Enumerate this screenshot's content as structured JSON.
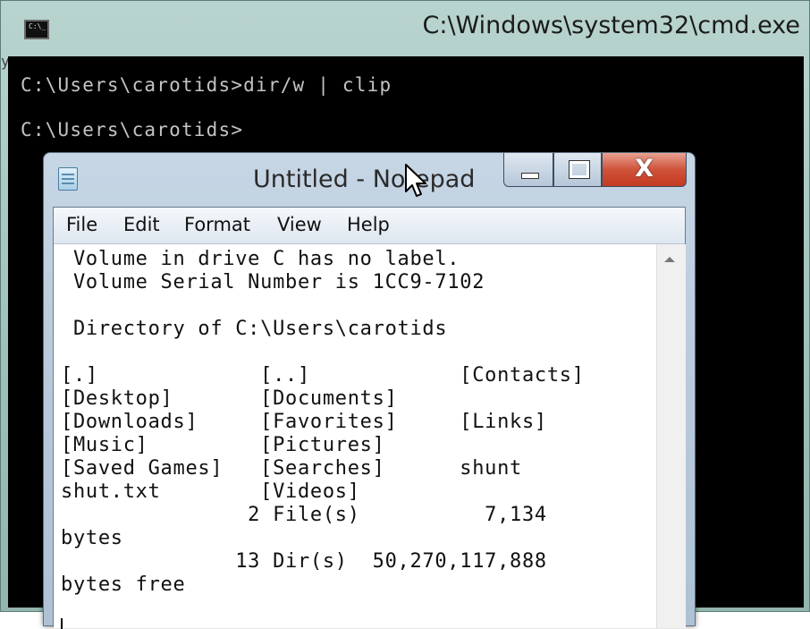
{
  "cmd": {
    "title": "C:\\Windows\\system32\\cmd.exe",
    "icon_text": "C:\\_",
    "edge_char": "y",
    "lines": [
      "C:\\Users\\carotids>dir/w | clip",
      "C:\\Users\\carotids>"
    ]
  },
  "notepad": {
    "title": "Untitled - Notepad",
    "close_glyph": "X",
    "menu": [
      "File",
      "Edit",
      "Format",
      "View",
      "Help"
    ],
    "lines": [
      " Volume in drive C has no label.",
      " Volume Serial Number is 1CC9-7102",
      "",
      " Directory of C:\\Users\\carotids",
      "",
      "[.]             [..]            [Contacts]",
      "[Desktop]       [Documents]",
      "[Downloads]     [Favorites]     [Links]",
      "[Music]         [Pictures]",
      "[Saved Games]   [Searches]      shunt",
      "shut.txt        [Videos]",
      "               2 File(s)          7,134",
      "bytes",
      "              13 Dir(s)  50,270,117,888",
      "bytes free"
    ]
  },
  "colors": {
    "console_bg": "#000000",
    "console_text": "#c4c4c4",
    "close_button": "#c33b22",
    "window_frame_cmd": "#9fc0ba",
    "window_frame_notepad": "#b7c9da"
  }
}
